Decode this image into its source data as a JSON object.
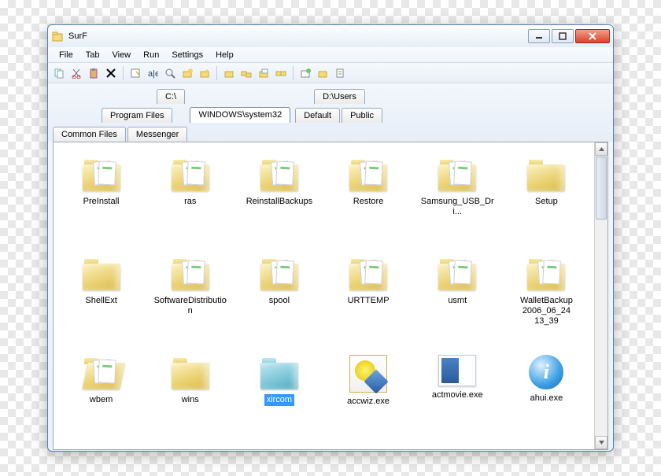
{
  "window": {
    "title": "SurF"
  },
  "menu": [
    "File",
    "Tab",
    "View",
    "Run",
    "Settings",
    "Help"
  ],
  "toolbar_icons": [
    "copy",
    "cut",
    "paste",
    "delete",
    "properties",
    "rename",
    "search",
    "new-folder",
    "new-file",
    "folder-up",
    "folder-tree",
    "copy-path",
    "refresh",
    "favorites",
    "clipboard",
    "options"
  ],
  "tabs": {
    "row0": [
      {
        "label": "C:\\",
        "indent": 130
      },
      {
        "label": "D:\\Users",
        "indent": 90
      }
    ],
    "row1": [
      {
        "label": "Program Files",
        "indent": 60
      },
      {
        "label": "WINDOWS\\system32",
        "active": true,
        "indent": 18
      },
      {
        "label": "Default",
        "indent": 2
      },
      {
        "label": "Public",
        "indent": 0
      }
    ],
    "row2": [
      {
        "label": "Common Files",
        "indent": 0
      },
      {
        "label": "Messenger",
        "indent": 0
      }
    ]
  },
  "items": [
    {
      "name": "PreInstall",
      "type": "folder-docs"
    },
    {
      "name": "ras",
      "type": "folder-docs"
    },
    {
      "name": "ReinstallBackups",
      "type": "folder-docs"
    },
    {
      "name": "Restore",
      "type": "folder-docs"
    },
    {
      "name": "Samsung_USB_Dri...",
      "type": "folder-docs"
    },
    {
      "name": "Setup",
      "type": "folder"
    },
    {
      "name": "ShellExt",
      "type": "folder"
    },
    {
      "name": "SoftwareDistribution",
      "type": "folder-docs"
    },
    {
      "name": "spool",
      "type": "folder-docs"
    },
    {
      "name": "URTTEMP",
      "type": "folder-docs"
    },
    {
      "name": "usmt",
      "type": "folder-docs"
    },
    {
      "name": "WalletBackup 2006_06_24 13_39",
      "type": "folder-docs"
    },
    {
      "name": "wbem",
      "type": "folder-open"
    },
    {
      "name": "wins",
      "type": "folder"
    },
    {
      "name": "xircom",
      "type": "folder-blue",
      "selected": true
    },
    {
      "name": "accwiz.exe",
      "type": "exe-accwiz"
    },
    {
      "name": "actmovie.exe",
      "type": "exe-actmovie"
    },
    {
      "name": "ahui.exe",
      "type": "exe-ahui"
    }
  ]
}
